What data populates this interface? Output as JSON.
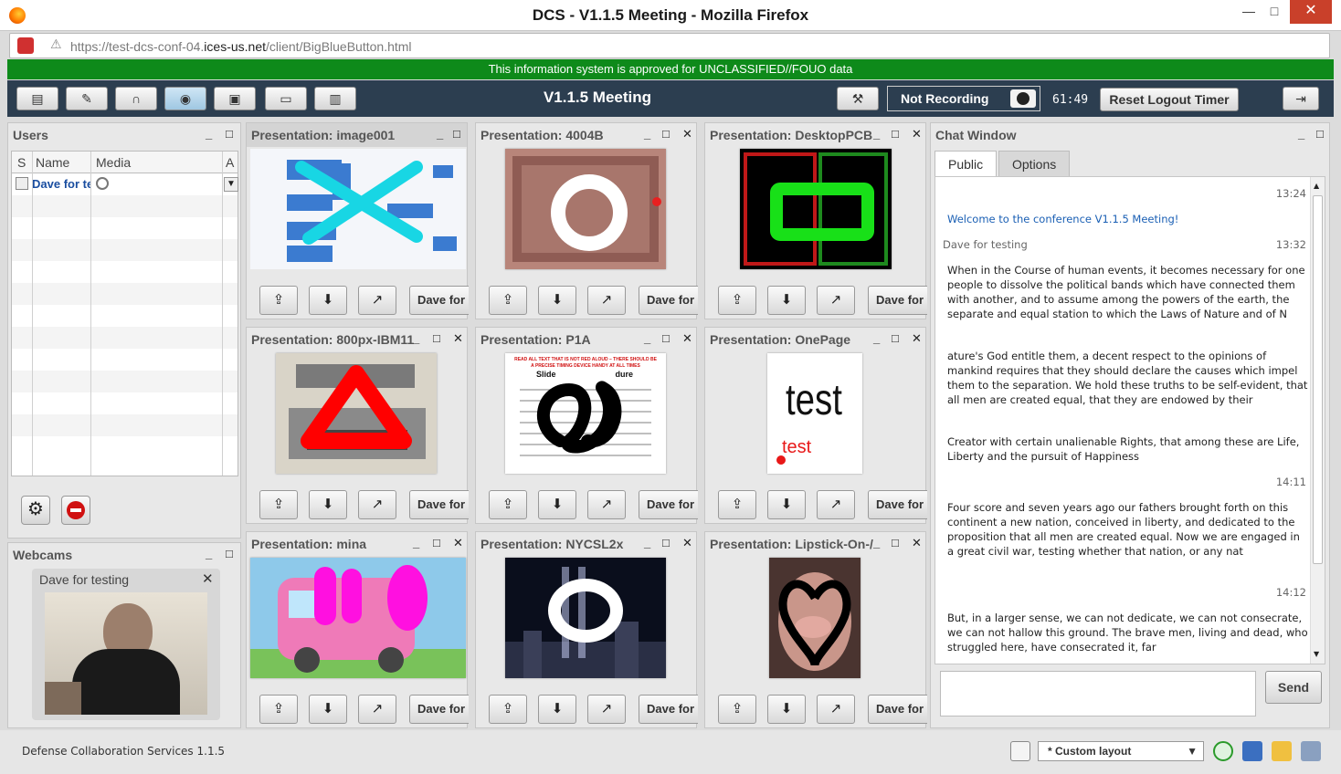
{
  "window": {
    "title": "DCS - V1.1.5 Meeting - Mozilla Firefox",
    "minimize": "—",
    "maximize": "□",
    "close": "✕"
  },
  "browser": {
    "url_prefix": "https://test-dcs-conf-04.",
    "url_domain": "ices-us.net",
    "url_path": "/client/BigBlueButton.html"
  },
  "banner": {
    "text": "This information system is approved for UNCLASSIFIED//FOUO data",
    "color": "#0e8a1a"
  },
  "toolbar": {
    "meeting_title": "V1.1.5 Meeting",
    "recording_label": "Not Recording",
    "timer": "61:49",
    "reset_label": "Reset Logout Timer",
    "buttons": [
      "presentation-icon",
      "chat-icon",
      "headset-icon",
      "webcam-icon",
      "desktop-share-icon",
      "monitor-icon",
      "chart-icon"
    ]
  },
  "users": {
    "title": "Users",
    "columns": {
      "status": "S",
      "name": "Name",
      "media": "Media",
      "actions": "A"
    },
    "rows": [
      {
        "name": "Dave for testing",
        "name_display": "Dave for te"
      }
    ]
  },
  "webcams": {
    "title": "Webcams",
    "user": "Dave for testing"
  },
  "presentations": [
    {
      "title": "Presentation: image001",
      "owner": "Dave for"
    },
    {
      "title": "Presentation: 4004B",
      "owner": "Dave for"
    },
    {
      "title": "Presentation: DesktopPCB",
      "owner": "Dave for"
    },
    {
      "title": "Presentation: 800px-IBM11",
      "owner": "Dave for"
    },
    {
      "title": "Presentation: P1A",
      "owner": "Dave for"
    },
    {
      "title": "Presentation: OnePage",
      "owner": "Dave for"
    },
    {
      "title": "Presentation: mina",
      "owner": "Dave for"
    },
    {
      "title": "Presentation: NYCSL2x",
      "owner": "Dave for"
    },
    {
      "title": "Presentation: Lipstick-On-/",
      "owner": "Dave for"
    }
  ],
  "slide_text": {
    "onepage_big": "test",
    "onepage_small": "test",
    "p1a_header": "READ ALL TEXT THAT IS NOT RED ALOUD – THERE SHOULD BE A PRECISE TIMING DEVICE HANDY AT ALL TIMES",
    "p1a_sub": "Slide                          dure"
  },
  "chat": {
    "title": "Chat Window",
    "tabs": [
      "Public",
      "Options"
    ],
    "messages": [
      {
        "time": "13:24"
      },
      {
        "text": "Welcome to the conference V1.1.5 Meeting!"
      },
      {
        "sender": "Dave for testing",
        "time": "13:32"
      },
      {
        "text": "When in the Course of human events, it becomes necessary for one people to dissolve the political bands which have connected them with another, and to assume among the powers of the earth, the separate and equal station to which the Laws of Nature and of N"
      },
      {
        "text": "ature's God entitle them, a decent respect to the opinions of mankind requires that they should declare the causes which impel them to the separation.  We hold these truths to be self-evident, that all men are created equal, that they are endowed by their"
      },
      {
        "text": "Creator with certain unalienable Rights, that among these are Life, Liberty and the pursuit of Happiness"
      },
      {
        "time": "14:11"
      },
      {
        "text": "Four score and seven years ago our fathers brought forth on this continent a new nation, conceived in liberty, and dedicated to the proposition that all men are created equal. Now we are engaged in a great civil war, testing whether that nation, or any nat"
      },
      {
        "time": "14:12"
      },
      {
        "text": "But, in a larger sense, we can not dedicate, we can not consecrate, we can not hallow this ground. The brave men, living and dead, who struggled here, have consecrated it, far"
      }
    ],
    "send_label": "Send"
  },
  "status": {
    "label": "Defense Collaboration Services 1.1.5",
    "layout": "* Custom layout"
  }
}
